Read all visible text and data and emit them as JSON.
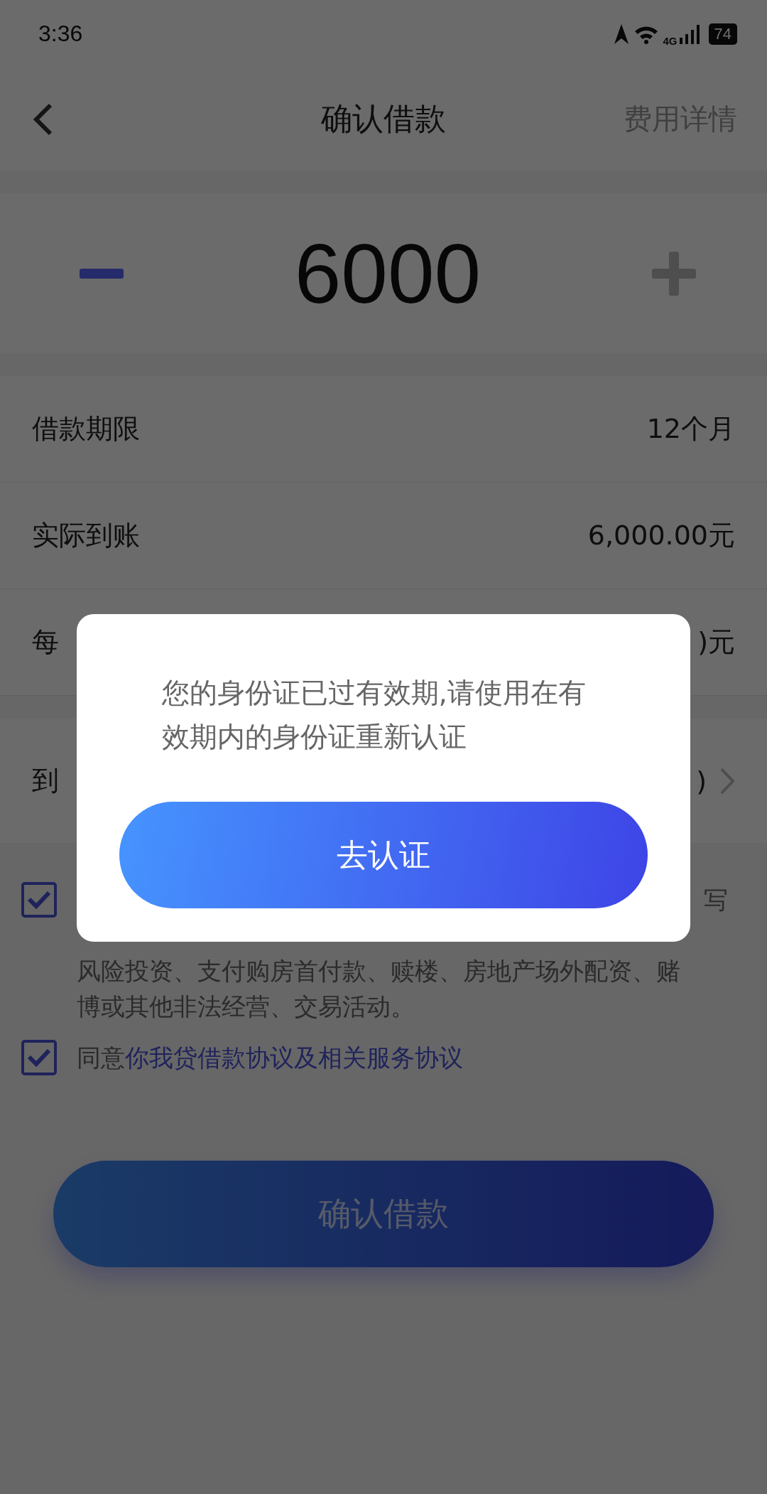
{
  "status_bar": {
    "time": "3:36",
    "network": "4G",
    "battery": "74"
  },
  "header": {
    "title": "确认借款",
    "action": "费用详情"
  },
  "amount": {
    "value": "6000"
  },
  "rows": [
    {
      "kind": "plain",
      "label": "借款期限",
      "value": "12个月"
    },
    {
      "kind": "plain",
      "label": "实际到账",
      "value": "6,000.00元"
    },
    {
      "kind": "plain",
      "label": "每",
      "value": ")元"
    },
    {
      "kind": "link",
      "label": "到",
      "value": ")"
    }
  ],
  "agreements": [
    {
      "kind": "purpose",
      "checked": true,
      "tail": "写",
      "text": "风险投资、支付购房首付款、赎楼、房地产场外配资、赌博或其他非法经营、交易活动。"
    },
    {
      "kind": "contract",
      "checked": true,
      "text": "同意",
      "link": "你我贷借款协议及相关服务协议"
    }
  ],
  "submit": "确认借款",
  "dialog": {
    "message": "您的身份证已过有效期,请使用在有效期内的身份证重新认证",
    "button": "去认证"
  }
}
